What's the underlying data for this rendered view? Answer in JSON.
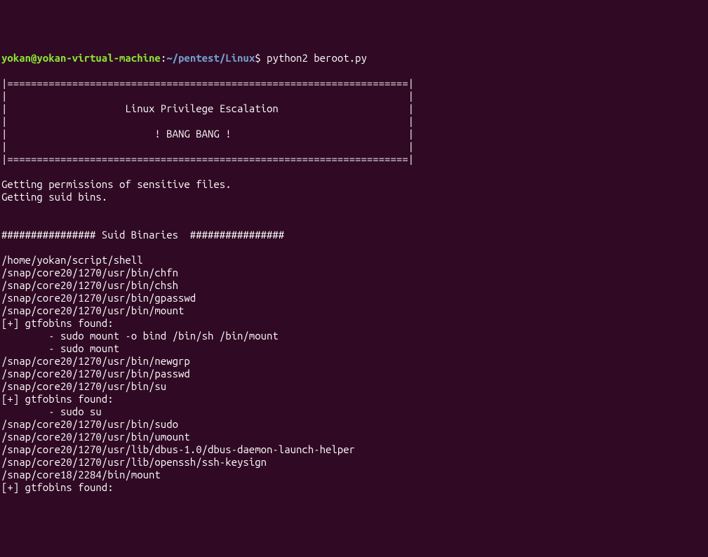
{
  "prompt": {
    "user_host": "yokan@yokan-virtual-machine",
    "colon": ":",
    "path": "~/pentest/Linux",
    "dollar": "$",
    "command": "python2 beroot.py"
  },
  "banner": [
    "",
    "|====================================================================|",
    "|                                                                    |",
    "|                    Linux Privilege Escalation                      |",
    "|                                                                    |",
    "|                         ! BANG BANG !                              |",
    "|                                                                    |",
    "|====================================================================|",
    ""
  ],
  "status": [
    "Getting permissions of sensitive files.",
    "Getting suid bins.",
    "",
    ""
  ],
  "section_header": "################ Suid Binaries  ################",
  "suid_output": [
    "",
    "/home/yokan/script/shell",
    "/snap/core20/1270/usr/bin/chfn",
    "/snap/core20/1270/usr/bin/chsh",
    "/snap/core20/1270/usr/bin/gpasswd",
    "/snap/core20/1270/usr/bin/mount",
    "[+] gtfobins found:",
    "        - sudo mount -o bind /bin/sh /bin/mount",
    "        - sudo mount",
    "/snap/core20/1270/usr/bin/newgrp",
    "/snap/core20/1270/usr/bin/passwd",
    "/snap/core20/1270/usr/bin/su",
    "[+] gtfobins found:",
    "        - sudo su",
    "/snap/core20/1270/usr/bin/sudo",
    "/snap/core20/1270/usr/bin/umount",
    "/snap/core20/1270/usr/lib/dbus-1.0/dbus-daemon-launch-helper",
    "/snap/core20/1270/usr/lib/openssh/ssh-keysign",
    "/snap/core18/2284/bin/mount",
    "[+] gtfobins found:"
  ]
}
